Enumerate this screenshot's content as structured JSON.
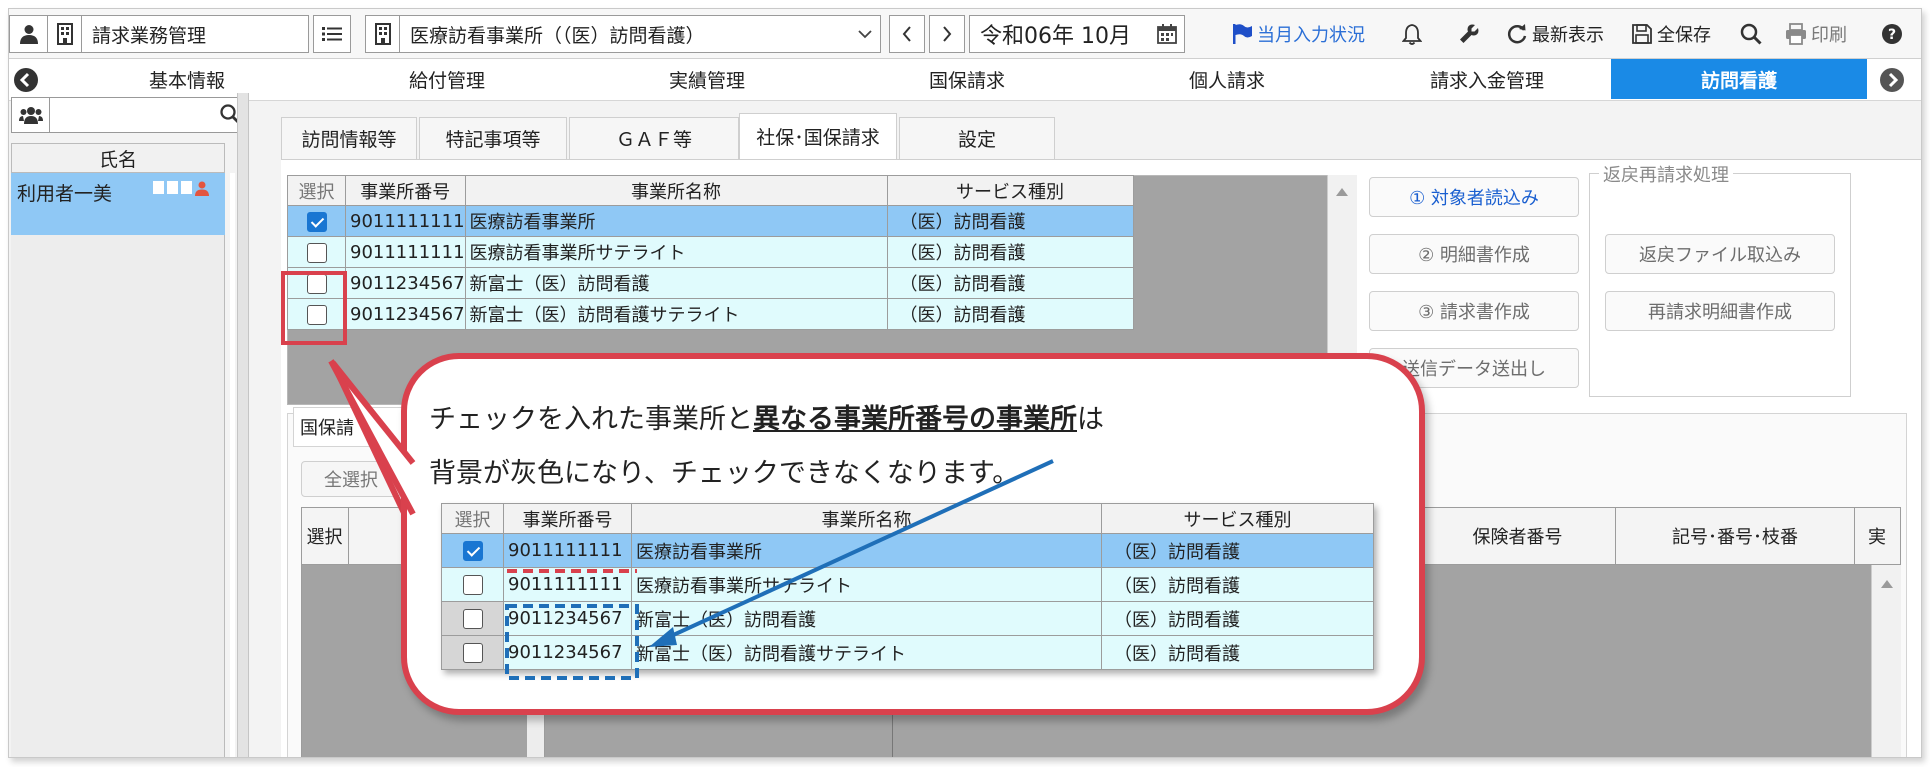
{
  "app": {
    "module_title": "請求業務管理",
    "office_select": "医療訪看事業所（（医）訪問看護）",
    "period": "令和06年 10月"
  },
  "toolbar": {
    "status_label": "当月入力状況",
    "refresh_label": "最新表示",
    "save_all_label": "全保存",
    "print_label": "印刷"
  },
  "nav": {
    "tabs": [
      "基本情報",
      "給付管理",
      "実績管理",
      "国保請求",
      "個人請求",
      "請求入金管理",
      "訪問看護"
    ],
    "active": "訪問看護"
  },
  "left": {
    "name_header": "氏名",
    "user_name": "利用者一美"
  },
  "subtabs": [
    "訪問情報等",
    "特記事項等",
    "ＧＡＦ等",
    "社保･国保請求",
    "設定"
  ],
  "office_grid": {
    "headers": [
      "選択",
      "事業所番号",
      "事業所名称",
      "サービス種別"
    ],
    "rows": [
      {
        "checked": true,
        "number": "9011111111",
        "name": "医療訪看事業所",
        "service": "（医）訪問看護"
      },
      {
        "checked": false,
        "number": "9011111111",
        "name": "医療訪看事業所サテライト",
        "service": "（医）訪問看護"
      },
      {
        "checked": false,
        "number": "9011234567",
        "name": "新富士（医）訪問看護",
        "service": "（医）訪問看護"
      },
      {
        "checked": false,
        "number": "9011234567",
        "name": "新富士（医）訪問看護サテライト",
        "service": "（医）訪問看護"
      }
    ]
  },
  "actions": {
    "load_targets": "① 対象者読込み",
    "create_detail": "② 明細書作成",
    "create_invoice": "③ 請求書作成",
    "send_data": "送信データ送出し",
    "return_group": "返戻再請求処理",
    "import_return": "返戻ファイル取込み",
    "recreate_detail": "再請求明細書作成"
  },
  "lower": {
    "section_label": "国保請",
    "select_all": "全選択",
    "col_select": "選択",
    "col_insurer": "保険者番号",
    "col_symbol": "記号･番号･枝番",
    "col_extra": "実"
  },
  "callout": {
    "text_before": "チェックを入れた事業所と",
    "text_bold": "異なる事業所番号の事業所",
    "text_after": "は",
    "line2": "背景が灰色になり、チェックできなくなります。"
  },
  "colors": {
    "accent": "#1a8ae6",
    "selected_row": "#8fc8f5",
    "row_bg": "#e0fbfd",
    "callout_border": "#d9414d",
    "arrow": "#1f6fb8"
  }
}
